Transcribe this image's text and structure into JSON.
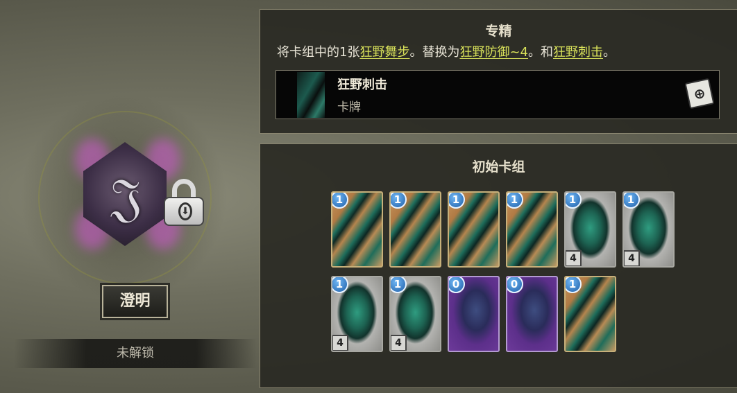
{
  "left": {
    "name": "澄明",
    "status": "未解锁"
  },
  "mastery": {
    "title": "专精",
    "desc_prefix": "将卡组中的1张",
    "kw1": "狂野舞步",
    "desc_mid1": "。替换为",
    "kw2": "狂野防御~4",
    "desc_mid2": "。和",
    "kw3": "狂野刺击",
    "desc_suffix": "。",
    "card_name": "狂野刺击",
    "card_type": "卡牌"
  },
  "deck": {
    "title": "初始卡组",
    "cards": [
      {
        "art": "slash",
        "cost": "1",
        "block": ""
      },
      {
        "art": "slash",
        "cost": "1",
        "block": ""
      },
      {
        "art": "slash",
        "cost": "1",
        "block": ""
      },
      {
        "art": "slash",
        "cost": "1",
        "block": ""
      },
      {
        "art": "shield",
        "cost": "1",
        "block": "4"
      },
      {
        "art": "shield",
        "cost": "1",
        "block": "4"
      },
      {
        "art": "shield",
        "cost": "1",
        "block": "4"
      },
      {
        "art": "shield",
        "cost": "1",
        "block": "4"
      },
      {
        "art": "dance",
        "cost": "0",
        "block": ""
      },
      {
        "art": "dance",
        "cost": "0",
        "block": ""
      },
      {
        "art": "slash",
        "cost": "1",
        "block": ""
      }
    ]
  },
  "icons": {
    "lock": "padlock-icon",
    "zoom": "magnify-card-icon"
  }
}
